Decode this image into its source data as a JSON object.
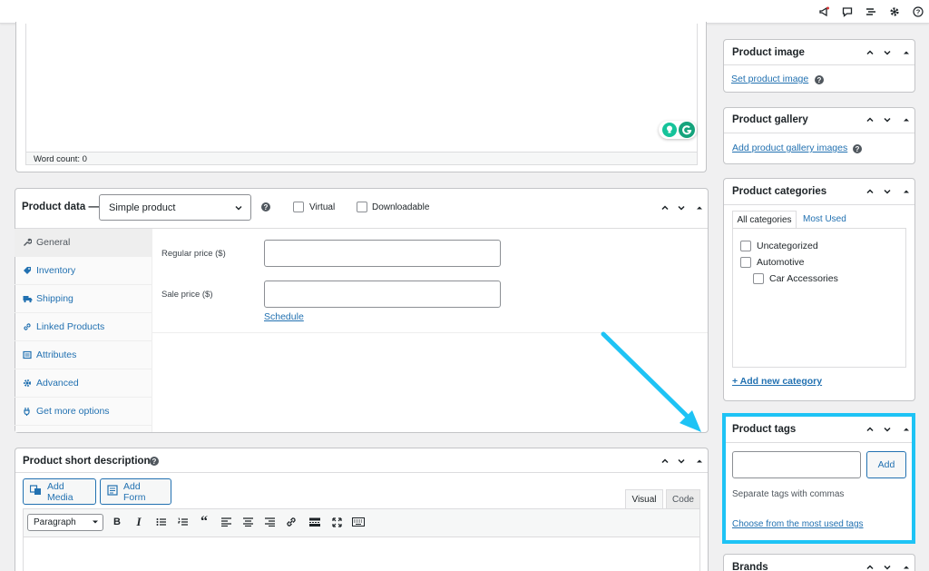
{
  "editor": {
    "word_count": "Word count: 0"
  },
  "product_data": {
    "title": "Product data —",
    "type_select": "Simple product",
    "virtual_label": "Virtual",
    "downloadable_label": "Downloadable",
    "tabs": [
      {
        "label": "General",
        "icon": "wrench-icon"
      },
      {
        "label": "Inventory",
        "icon": "tag-icon"
      },
      {
        "label": "Shipping",
        "icon": "truck-icon"
      },
      {
        "label": "Linked Products",
        "icon": "link-icon"
      },
      {
        "label": "Attributes",
        "icon": "list-icon"
      },
      {
        "label": "Advanced",
        "icon": "gear-icon"
      },
      {
        "label": "Get more options",
        "icon": "plugin-icon"
      }
    ],
    "regular_price_label": "Regular price ($)",
    "sale_price_label": "Sale price ($)",
    "schedule_link": "Schedule"
  },
  "short_description": {
    "title": "Product short description",
    "add_media": "Add Media",
    "add_form": "Add Form",
    "tab_visual": "Visual",
    "tab_code": "Code",
    "format_select": "Paragraph"
  },
  "sidebar": {
    "product_image": {
      "title": "Product image",
      "link": "Set product image"
    },
    "product_gallery": {
      "title": "Product gallery",
      "link": "Add product gallery images"
    },
    "product_categories": {
      "title": "Product categories",
      "tab_all": "All categories",
      "tab_most_used": "Most Used",
      "items": [
        "Uncategorized",
        "Automotive",
        "Car Accessories"
      ],
      "add_link": "+ Add new category"
    },
    "product_tags": {
      "title": "Product tags",
      "add_button": "Add",
      "hint": "Separate tags with commas",
      "choose_link": "Choose from the most used tags"
    },
    "brands": {
      "title": "Brands"
    }
  },
  "colors": {
    "highlight": "#1ec3f5",
    "link": "#2271b1"
  }
}
